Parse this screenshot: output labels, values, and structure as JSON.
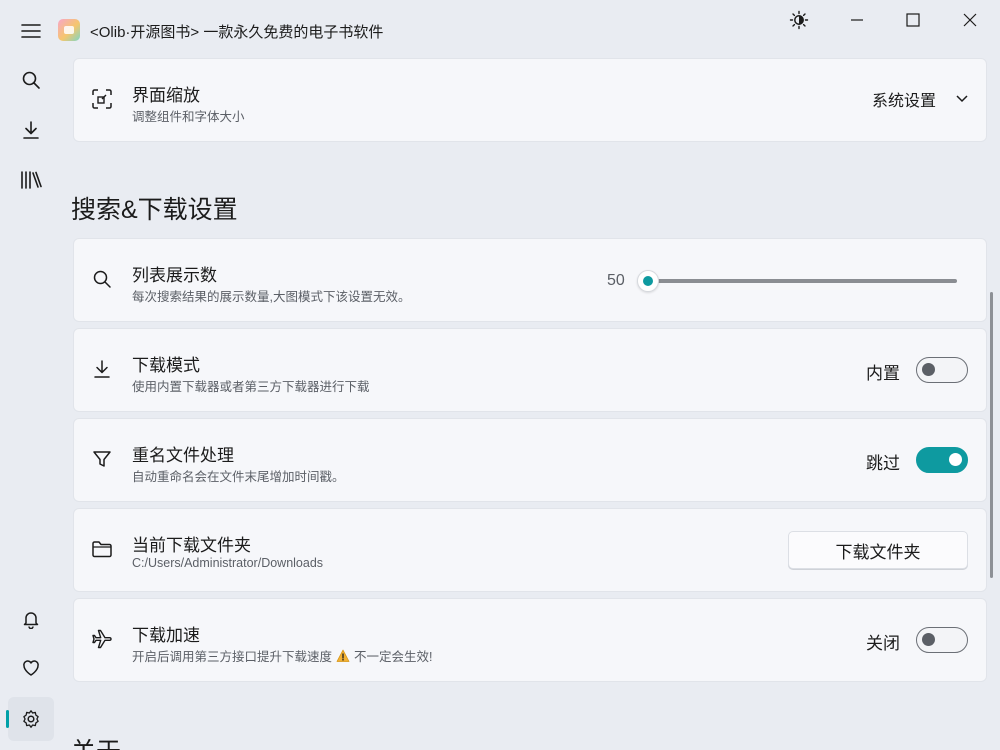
{
  "app": {
    "title": "<Olib·开源图书> 一款永久免费的电子书软件"
  },
  "rail": {
    "top_items": [
      "search-icon",
      "download-icon",
      "library-icon"
    ],
    "bottom_items": [
      "bell-icon",
      "heart-icon",
      "settings-icon"
    ],
    "active": "settings-icon"
  },
  "display_scale": {
    "title": "界面缩放",
    "desc": "调整组件和字体大小",
    "value": "系统设置"
  },
  "section_search_download": {
    "title": "搜索&下载设置"
  },
  "list_count": {
    "title": "列表展示数",
    "desc": "每次搜索结果的展示数量,大图模式下该设置无效。",
    "value": "50",
    "slider_fraction": 0.0
  },
  "download_mode": {
    "title": "下载模式",
    "desc": "使用内置下载器或者第三方下载器进行下载",
    "state_label": "内置",
    "on": false
  },
  "rename": {
    "title": "重名文件处理",
    "desc": "自动重命名会在文件末尾增加时间戳。",
    "state_label": "跳过",
    "on": true
  },
  "download_folder": {
    "title": "当前下载文件夹",
    "path": "C:/Users/Administrator/Downloads",
    "button_label": "下载文件夹"
  },
  "accelerate": {
    "title": "下载加速",
    "desc_part1": "开启后调用第三方接口提升下载速度",
    "desc_part2": "不一定会生效!",
    "state_label": "关闭",
    "on": false
  },
  "section_about": {
    "title": "关于"
  },
  "colors": {
    "accent": "#0e9aa0",
    "background": "#e9ecf2",
    "card": "#f6f7fa"
  }
}
